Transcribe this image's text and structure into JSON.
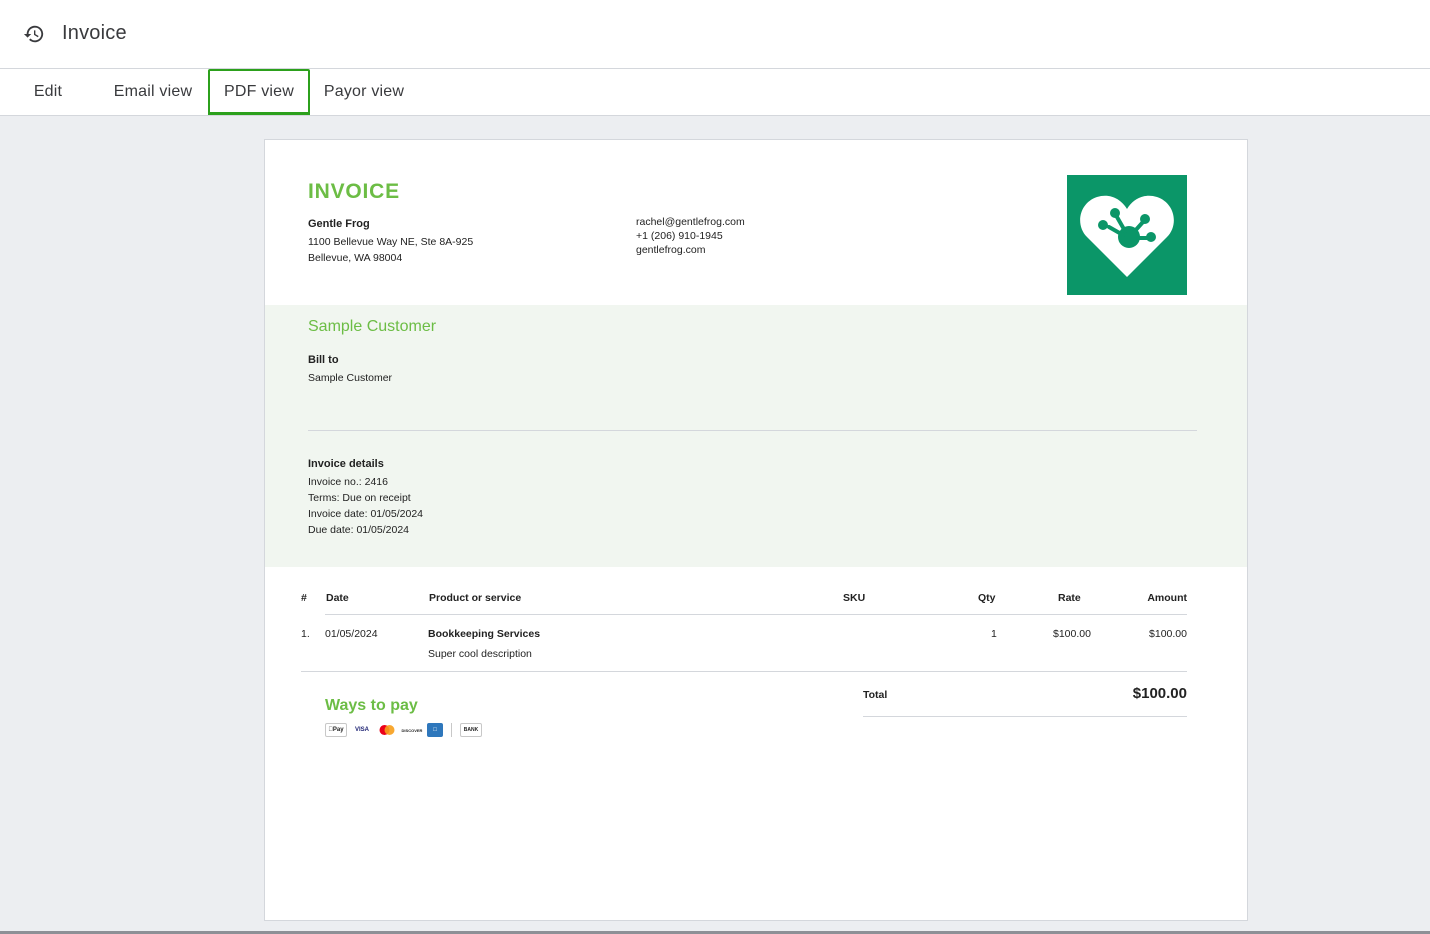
{
  "header": {
    "title": "Invoice",
    "history_icon": "history-icon"
  },
  "tabs": [
    {
      "label": "Edit",
      "active": false
    },
    {
      "label": "Email view",
      "active": false
    },
    {
      "label": "PDF view",
      "active": true
    },
    {
      "label": "Payor view",
      "active": false
    }
  ],
  "invoice": {
    "heading": "INVOICE",
    "accent_color": "#6cbd45",
    "logo_color": "#0b9668",
    "company": {
      "name": "Gentle Frog",
      "address_line1": "1100 Bellevue Way NE, Ste 8A-925",
      "address_line2": "Bellevue, WA 98004",
      "email": "rachel@gentlefrog.com",
      "phone": "+1 (206) 910-1945",
      "website": "gentlefrog.com"
    },
    "customer": {
      "name": "Sample Customer",
      "bill_to_label": "Bill to",
      "bill_to_value": "Sample Customer"
    },
    "details": {
      "label": "Invoice details",
      "number": "Invoice no.: 2416",
      "terms": "Terms: Due on receipt",
      "invoice_date": "Invoice date: 01/05/2024",
      "due_date": "Due date: 01/05/2024"
    },
    "table": {
      "headers": {
        "num": "#",
        "date": "Date",
        "product": "Product or service",
        "sku": "SKU",
        "qty": "Qty",
        "rate": "Rate",
        "amount": "Amount"
      },
      "rows": [
        {
          "num": "1.",
          "date": "01/05/2024",
          "product": "Bookkeeping Services",
          "description": "Super cool description",
          "sku": "",
          "qty": "1",
          "rate": "$100.00",
          "amount": "$100.00"
        }
      ]
    },
    "ways_to_pay": {
      "label": "Ways to pay",
      "methods": [
        "Pay",
        "VISA",
        "",
        "DISCOVER",
        "",
        "BANK"
      ]
    },
    "total": {
      "label": "Total",
      "value": "$100.00"
    }
  }
}
